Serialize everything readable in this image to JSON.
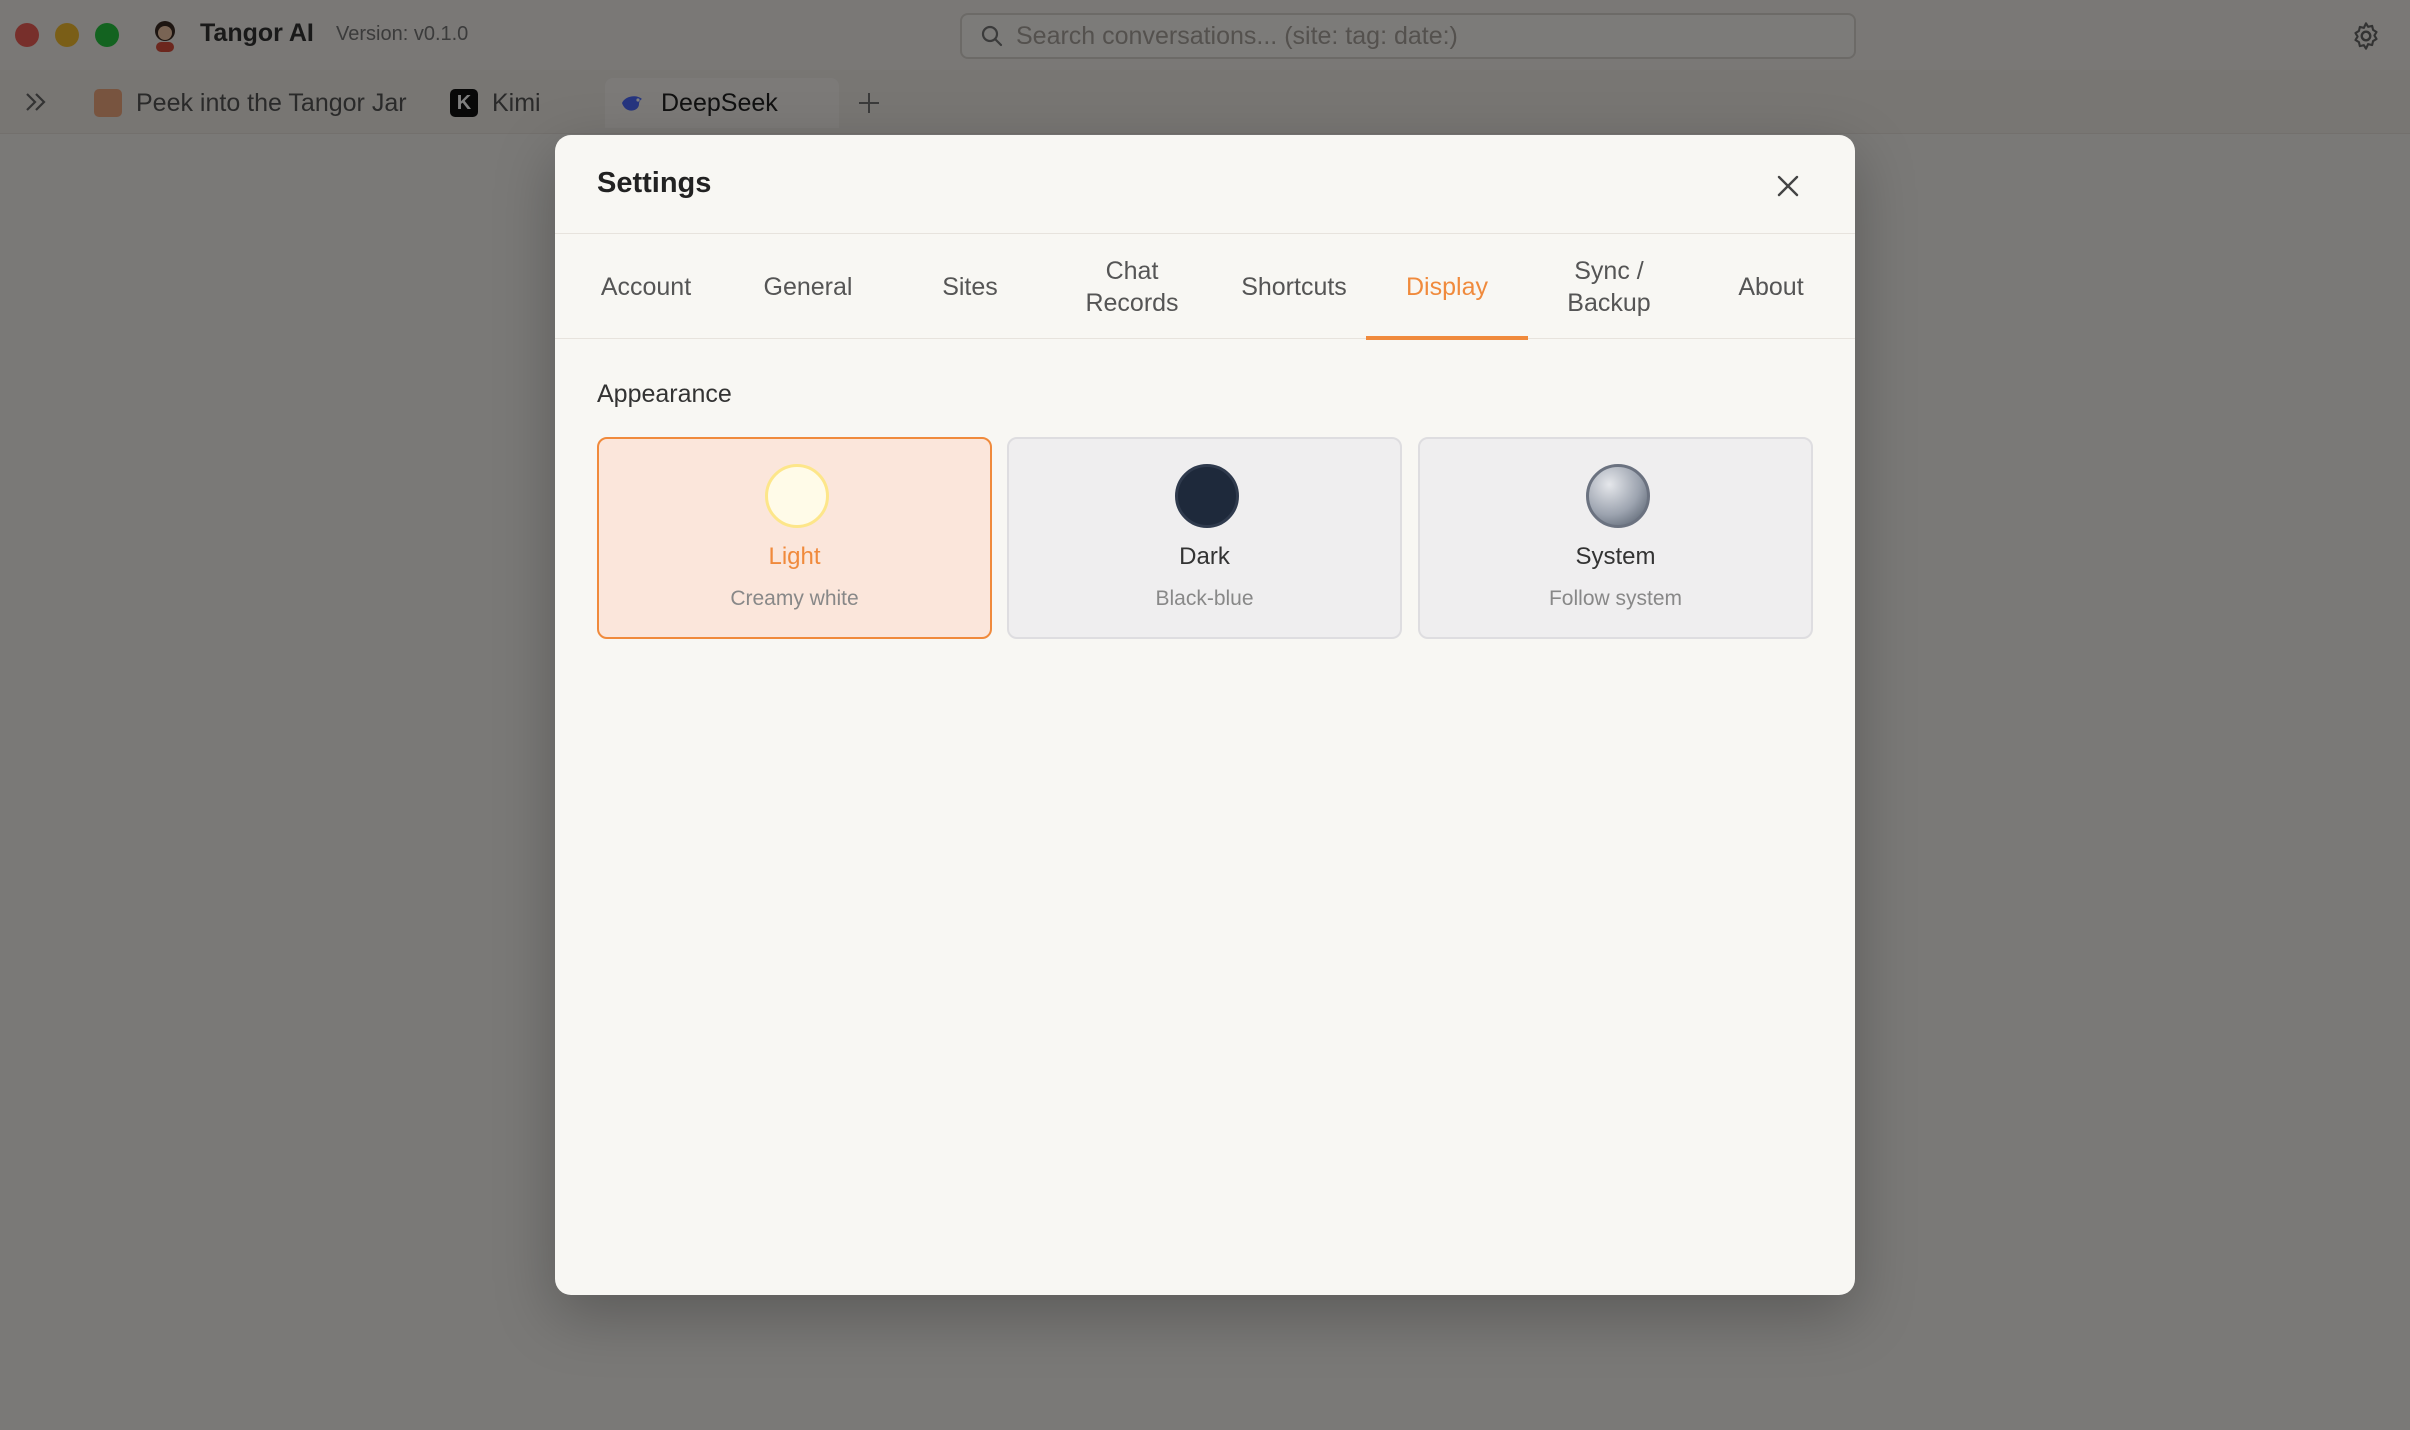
{
  "app": {
    "title": "Tangor AI",
    "version": "Version: v0.1.0"
  },
  "search": {
    "placeholder": "Search conversations... (site: tag: date:)"
  },
  "browser_tabs": [
    {
      "label": "Peek into the Tangor Jar",
      "icon": "jar-favicon"
    },
    {
      "label": "Kimi",
      "icon": "kimi-favicon",
      "glyph": "K"
    },
    {
      "label": "DeepSeek",
      "icon": "deepseek-favicon",
      "active": true
    }
  ],
  "settings": {
    "title": "Settings",
    "tabs": [
      {
        "label": "Account"
      },
      {
        "label": "General"
      },
      {
        "label": "Sites"
      },
      {
        "label": "Chat Records"
      },
      {
        "label": "Shortcuts"
      },
      {
        "label": "Display",
        "active": true
      },
      {
        "label": "Sync / Backup"
      },
      {
        "label": "About"
      }
    ],
    "section_label": "Appearance",
    "themes": [
      {
        "name": "Light",
        "description": "Creamy white",
        "selected": true,
        "swatch_color": "#fffbe8"
      },
      {
        "name": "Dark",
        "description": "Black-blue",
        "selected": false,
        "swatch_color": "#1e293b"
      },
      {
        "name": "System",
        "description": "Follow system",
        "selected": false,
        "swatch_color": "#9ca3af"
      }
    ]
  },
  "colors": {
    "accent": "#f08a3c",
    "modal_bg": "#f8f7f3",
    "selected_card_bg": "#fbe6db"
  }
}
